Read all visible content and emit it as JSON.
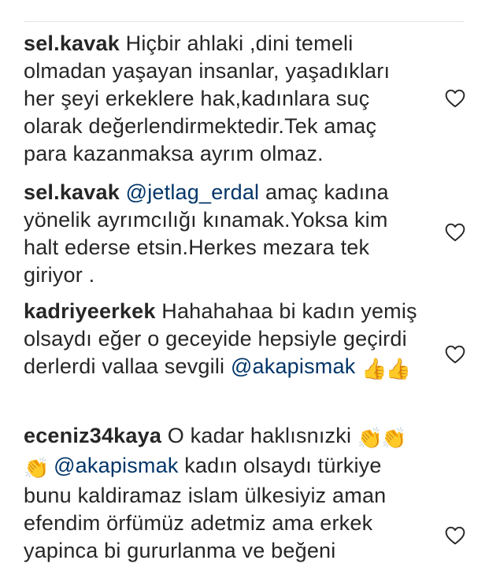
{
  "comments": [
    {
      "username": "sel.kavak",
      "text": "Hiçbir ahlaki ,dini temeli olmadan yaşayan insanlar, yaşadıkları her şeyi erkeklere hak,kadınlara suç olarak değerlendirmektedir.Tek amaç para kazanmaksa ayrım olmaz.",
      "like_icon": "heart-outline-icon"
    },
    {
      "username": "sel.kavak",
      "mention": "@jetlag_erdal",
      "text": "amaç kadına yönelik ayrımcılığı kınamak.Yoksa kim halt ederse etsin.Herkes mezara tek giriyor .",
      "like_icon": "heart-outline-icon"
    },
    {
      "username": "kadriyeerkek",
      "text": "Hahahahaa bi kadın yemiş olsaydı eğer o geceyide hepsiyle geçirdi derlerdi vallaa sevgili",
      "mention": "@akapismak",
      "emoji": "👍👍",
      "like_icon": "heart-outline-icon"
    },
    {
      "username": "eceniz34kaya",
      "text": "O kadar haklısnızki",
      "emoji": "👏👏👏",
      "mention": "@akapismak",
      "text2": "kadın olsaydı türkiye bunu kaldiramaz islam ülkesiyiz aman efendim örfümüz adetmiz ama erkek yapinca bi gururlanma ve beğeni",
      "like_icon": "heart-outline-icon"
    }
  ],
  "colors": {
    "text": "#262626",
    "mention": "#003569",
    "divider": "#e6e6e6"
  }
}
